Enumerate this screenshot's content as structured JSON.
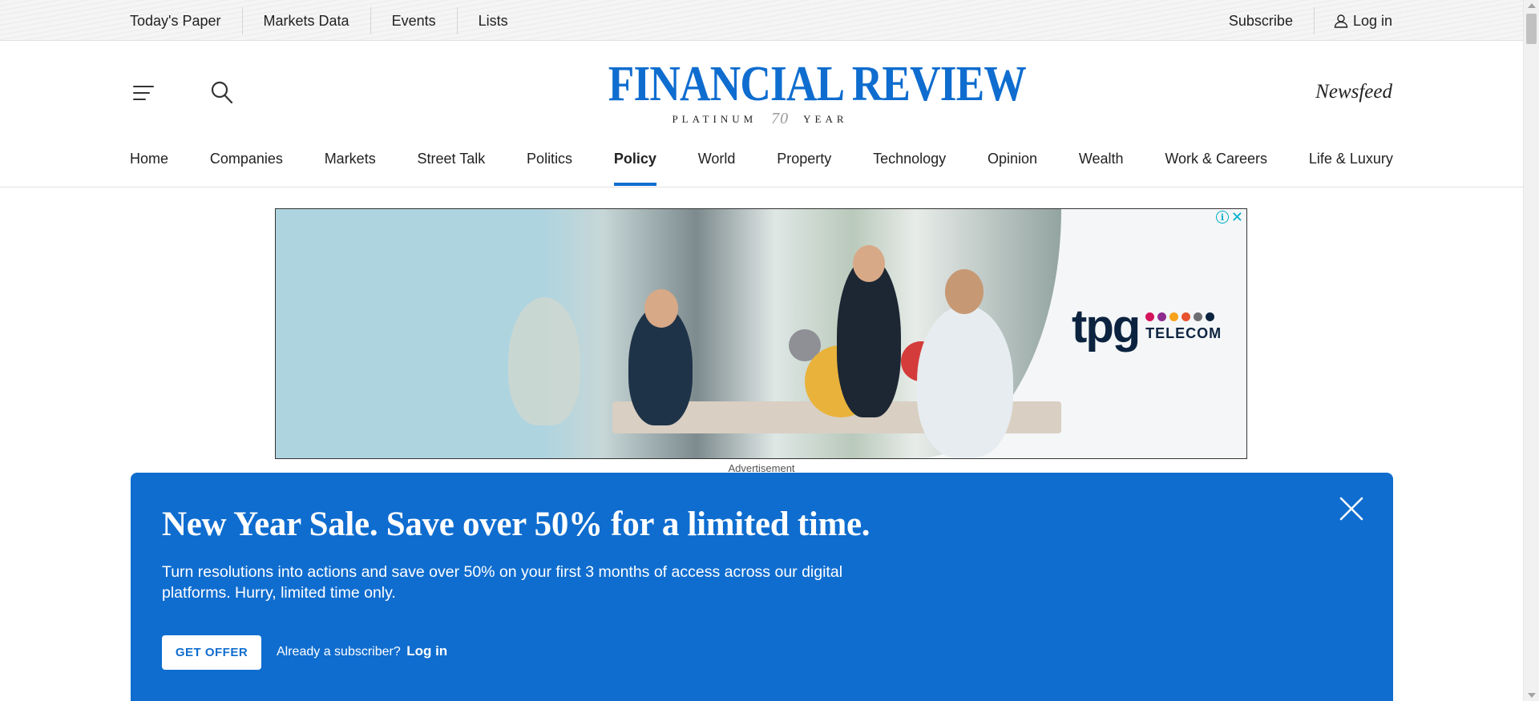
{
  "topbar": {
    "links": [
      "Today's Paper",
      "Markets Data",
      "Events",
      "Lists"
    ],
    "subscribe": "Subscribe",
    "login": "Log in"
  },
  "masthead": {
    "logo_name": "FINANCIAL REVIEW",
    "logo_platinum": "PLATINUM",
    "logo_seventy": "70",
    "logo_year": "YEAR",
    "newsfeed": "Newsfeed",
    "brand_color": "#0f6dcf"
  },
  "nav": {
    "items": [
      "Home",
      "Companies",
      "Markets",
      "Street Talk",
      "Politics",
      "Policy",
      "World",
      "Property",
      "Technology",
      "Opinion",
      "Wealth",
      "Work & Careers",
      "Life & Luxury"
    ],
    "active": "Policy"
  },
  "ad": {
    "brand": "tpg",
    "brand_sub": "TELECOM",
    "dot_colors": [
      "#d4145a",
      "#8e2b8f",
      "#f7a21b",
      "#e8522e",
      "#6d6e71",
      "#0c2340"
    ],
    "label": "Advertisement"
  },
  "promo": {
    "headline": "New Year Sale. Save over 50% for a limited time.",
    "body": "Turn resolutions into actions and save over 50% on your first 3 months of access across our digital platforms. Hurry, limited time only.",
    "cta": "GET OFFER",
    "already": "Already a subscriber?",
    "login": "Log in",
    "background": "#0f6dcf"
  }
}
